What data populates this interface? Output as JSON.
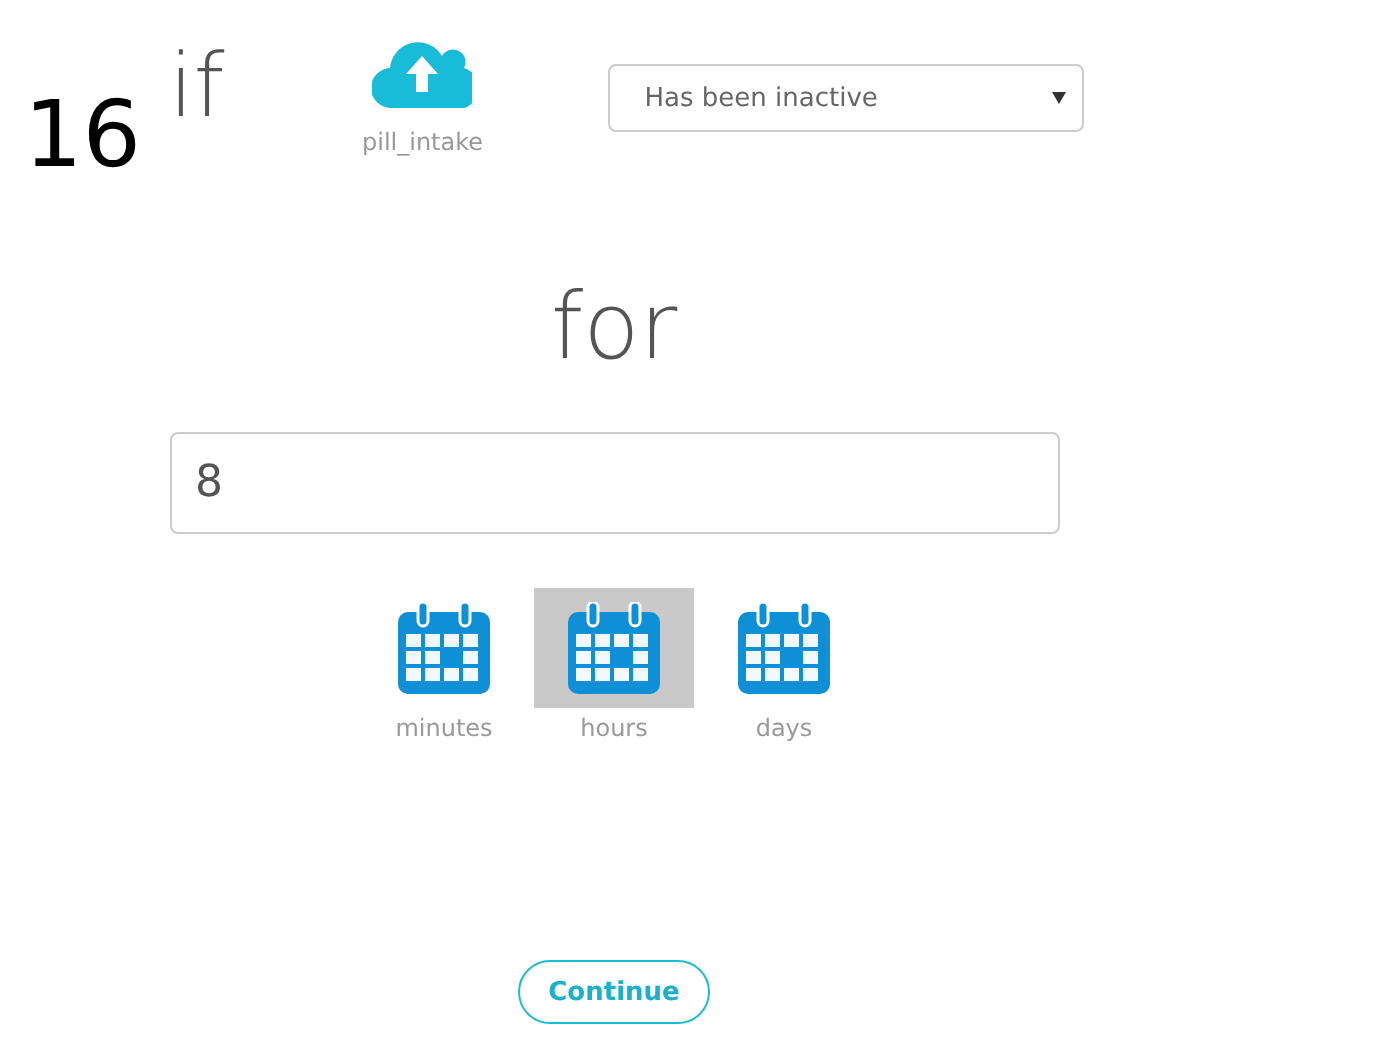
{
  "step": "16",
  "condition": "if",
  "source": {
    "label": "pill_intake"
  },
  "state_select": {
    "value": "Has been inactive"
  },
  "connector": "for",
  "duration": {
    "value": "8"
  },
  "units": [
    {
      "label": "minutes",
      "selected": false
    },
    {
      "label": "hours",
      "selected": true
    },
    {
      "label": "days",
      "selected": false
    }
  ],
  "continue_button": "Continue"
}
